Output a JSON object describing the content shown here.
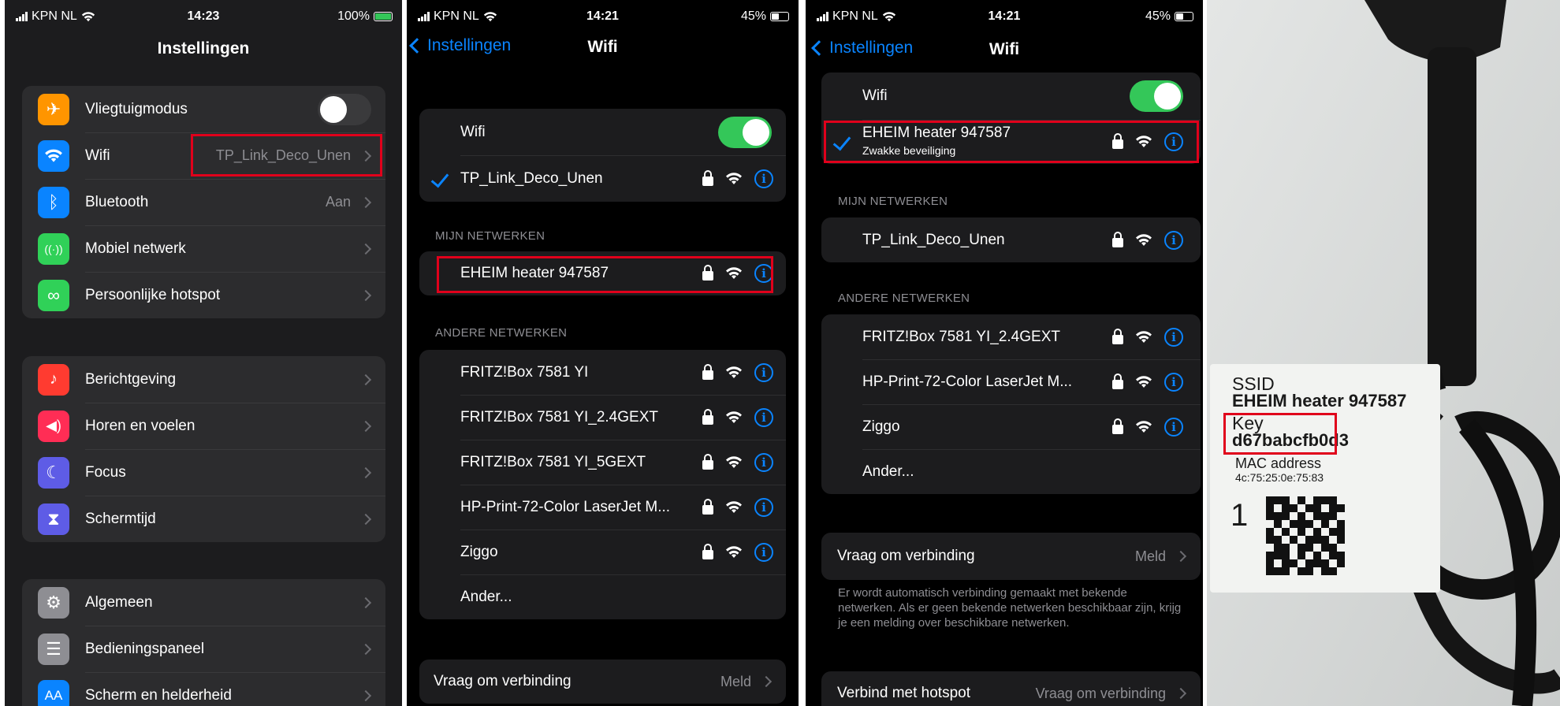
{
  "panel1": {
    "status": {
      "carrier": "KPN NL",
      "time": "14:23",
      "battery": "100%"
    },
    "title": "Instellingen",
    "group1": [
      {
        "label": "Vliegtuigmodus",
        "icon": "airplane-icon",
        "color": "#ff9500",
        "glyph": "✈"
      },
      {
        "label": "Wifi",
        "icon": "wifi-icon",
        "color": "#0a84ff",
        "value": "TP_Link_Deco_Unen"
      },
      {
        "label": "Bluetooth",
        "icon": "bluetooth-icon",
        "color": "#0a84ff",
        "value": "Aan",
        "glyph": "ᛒ"
      },
      {
        "label": "Mobiel netwerk",
        "icon": "antenna-icon",
        "color": "#30d158",
        "glyph": "((·))"
      },
      {
        "label": "Persoonlijke hotspot",
        "icon": "hotspot-icon",
        "color": "#30d158",
        "glyph": "∞"
      }
    ],
    "group2": [
      {
        "label": "Berichtgeving",
        "icon": "bell-icon",
        "color": "#ff3b30",
        "glyph": "🔔"
      },
      {
        "label": "Horen en voelen",
        "icon": "speaker-icon",
        "color": "#ff2d55",
        "glyph": "🔊"
      },
      {
        "label": "Focus",
        "icon": "moon-icon",
        "color": "#5e5ce6",
        "glyph": "☾"
      },
      {
        "label": "Schermtijd",
        "icon": "hourglass-icon",
        "color": "#5e5ce6",
        "glyph": "⧗"
      }
    ],
    "group3": [
      {
        "label": "Algemeen",
        "icon": "gear-icon",
        "color": "#8e8e93",
        "glyph": "⚙"
      },
      {
        "label": "Bedieningspaneel",
        "icon": "switches-icon",
        "color": "#8e8e93",
        "glyph": "☰"
      },
      {
        "label": "Scherm en helderheid",
        "icon": "text-size-icon",
        "color": "#0a84ff",
        "glyph": "AA"
      }
    ]
  },
  "panel2": {
    "status": {
      "carrier": "KPN NL",
      "time": "14:21",
      "battery": "45%"
    },
    "back": "Instellingen",
    "title": "Wifi",
    "wifi_label": "Wifi",
    "connected": "TP_Link_Deco_Unen",
    "my_networks_header": "MIJN NETWERKEN",
    "my_networks": [
      "EHEIM heater 947587"
    ],
    "other_networks_header": "ANDERE NETWERKEN",
    "other_networks": [
      "FRITZ!Box 7581 YI",
      "FRITZ!Box 7581 YI_2.4GEXT",
      "FRITZ!Box 7581 YI_5GEXT",
      "HP-Print-72-Color LaserJet M...",
      "Ziggo"
    ],
    "other_label": "Ander...",
    "ask_label": "Vraag om verbinding",
    "ask_value": "Meld"
  },
  "panel3": {
    "status": {
      "carrier": "KPN NL",
      "time": "14:21",
      "battery": "45%"
    },
    "back": "Instellingen",
    "title": "Wifi",
    "wifi_label": "Wifi",
    "connected": "EHEIM heater 947587",
    "connected_sub": "Zwakke beveiliging",
    "my_networks_header": "MIJN NETWERKEN",
    "my_networks": [
      "TP_Link_Deco_Unen"
    ],
    "other_networks_header": "ANDERE NETWERKEN",
    "other_networks": [
      "FRITZ!Box 7581 YI_2.4GEXT",
      "HP-Print-72-Color LaserJet M...",
      "Ziggo"
    ],
    "other_label": "Ander...",
    "ask_label": "Vraag om verbinding",
    "ask_value": "Meld",
    "ask_footnote": "Er wordt automatisch verbinding gemaakt met bekende netwerken. Als er geen bekende netwerken beschikbaar zijn, krijg je een melding over beschikbare netwerken.",
    "hotspot_label": "Verbind met hotspot",
    "hotspot_value": "Vraag om verbinding"
  },
  "panel4": {
    "ssid_label": "SSID",
    "ssid": "EHEIM heater 947587",
    "key_label": "Key",
    "key": "d67babcfb0d3",
    "mac_label": "MAC address",
    "mac": "4c:75:25:0e:75:83",
    "qty": "1"
  }
}
